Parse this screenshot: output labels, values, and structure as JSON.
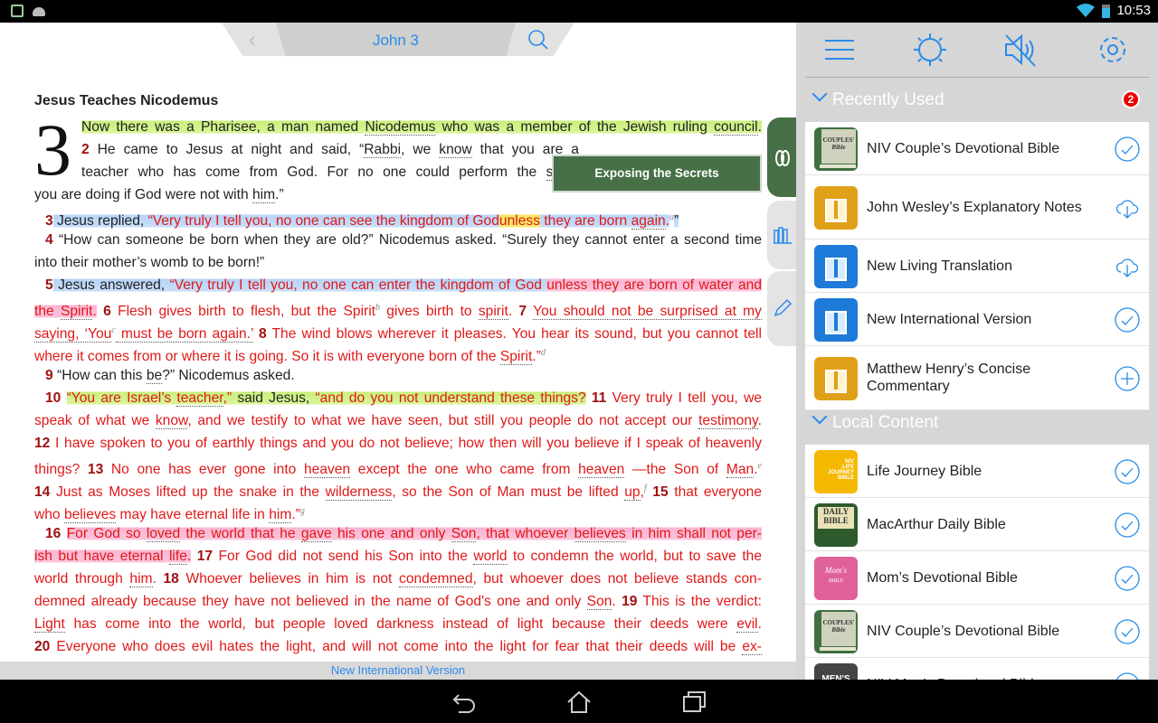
{
  "status": {
    "time": "10:53"
  },
  "header": {
    "chapter": "John 3"
  },
  "passage": {
    "heading": "Jesus Teaches Nicodemus",
    "chapter_number": "3",
    "promo_label": "Exposing the Secrets",
    "lines": [
      {
        "j": 1,
        "s": [
          [
            "Now there was a Pharisee, a man named ",
            "g"
          ],
          [
            "Nicodemus",
            "gu"
          ],
          [
            " who was a member of the Jewish ruling ",
            "g"
          ],
          [
            "council",
            "gu"
          ],
          [
            ".",
            "g"
          ]
        ]
      },
      {
        "j": 1,
        "s": [
          [
            "2",
            "v"
          ],
          [
            " He came to Jesus at night and said, “",
            ""
          ],
          [
            "Rabbi",
            "u"
          ],
          [
            ", we ",
            ""
          ],
          [
            "know",
            "u"
          ],
          [
            " that you are a",
            ""
          ]
        ]
      },
      {
        "j": 1,
        "s": [
          [
            "teacher who has come from God. For no one could perform the ",
            ""
          ],
          [
            "signs",
            "u"
          ]
        ]
      },
      {
        "j": 0,
        "s": [
          [
            "you are doing if God were not with ",
            ""
          ],
          [
            "him",
            "u"
          ],
          [
            ".”",
            ""
          ]
        ]
      },
      {
        "j": 0,
        "i": 1,
        "s": [
          [
            "3",
            "v"
          ],
          [
            " Jesus replied, ",
            "b"
          ],
          [
            "“Very truly I tell you, no one can see the kingdom of God",
            "rb"
          ],
          [
            "unless",
            "ry"
          ],
          [
            " they are born ",
            "rb"
          ],
          [
            "again",
            "rbu"
          ],
          [
            ".",
            "rb"
          ],
          [
            "a",
            "sup"
          ],
          [
            "”",
            "b"
          ]
        ]
      },
      {
        "j": 1,
        "i": 1,
        "s": [
          [
            "4",
            "v"
          ],
          [
            " “How can someone be born when they are old?” Nicodemus asked. “Surely they cannot enter a second time",
            ""
          ]
        ]
      },
      {
        "j": 0,
        "s": [
          [
            "into their mother’s womb to be born!”",
            ""
          ]
        ]
      },
      {
        "j": 1,
        "i": 1,
        "s": [
          [
            "5",
            "v"
          ],
          [
            " Jesus answered, ",
            "b"
          ],
          [
            "“Very truly I tell you, no one can enter the kingdom of God ",
            "rb"
          ],
          [
            "unless they are born of water and",
            "rp"
          ]
        ]
      },
      {
        "j": 1,
        "s": [
          [
            "the ",
            "rp"
          ],
          [
            "Spirit",
            "rpu"
          ],
          [
            ".",
            "rp"
          ],
          [
            " ",
            ""
          ],
          [
            "6",
            "v"
          ],
          [
            " Flesh gives birth to flesh, but the Spirit",
            "r"
          ],
          [
            "b",
            "sup"
          ],
          [
            " gives birth to ",
            "r"
          ],
          [
            "spirit",
            "ru"
          ],
          [
            ". ",
            "r"
          ],
          [
            "7",
            "v"
          ],
          [
            " ",
            ""
          ],
          [
            "You should not be surprised at my",
            "ru"
          ]
        ]
      },
      {
        "j": 1,
        "s": [
          [
            "saying, ‘You",
            "ru"
          ],
          [
            "c",
            "sup"
          ],
          [
            " must be born again.’",
            "ru"
          ],
          [
            " ",
            ""
          ],
          [
            "8",
            "v"
          ],
          [
            " The wind blows wherever it pleases. You hear its sound, but you cannot tell",
            "r"
          ]
        ]
      },
      {
        "j": 0,
        "s": [
          [
            "where it comes from or where it is going. So it is with everyone born of the ",
            "r"
          ],
          [
            "Spirit",
            "ru"
          ],
          [
            ".”",
            "r"
          ],
          [
            "d",
            "sup"
          ]
        ]
      },
      {
        "j": 0,
        "i": 1,
        "s": [
          [
            "9",
            "v"
          ],
          [
            " “How can this ",
            ""
          ],
          [
            "be",
            "u"
          ],
          [
            "?” Nicodemus asked.",
            ""
          ]
        ]
      },
      {
        "j": 1,
        "i": 1,
        "s": [
          [
            "10",
            "v"
          ],
          [
            " ",
            ""
          ],
          [
            "“You are Israel’s ",
            "rg"
          ],
          [
            "teacher",
            "rgu"
          ],
          [
            ",”",
            "rg"
          ],
          [
            " said Jesus, ",
            "g"
          ],
          [
            "“and do you not understand these things?",
            "rg"
          ],
          [
            " ",
            ""
          ],
          [
            "11",
            "v"
          ],
          [
            " Very truly I tell you, we",
            "r"
          ]
        ]
      },
      {
        "j": 1,
        "s": [
          [
            "speak of what we ",
            "r"
          ],
          [
            "know",
            "ru"
          ],
          [
            ", and we testify to what we have seen, but still you people do not accept our ",
            "r"
          ],
          [
            "testimony",
            "ru"
          ],
          [
            ".",
            "r"
          ]
        ]
      },
      {
        "j": 1,
        "s": [
          [
            "12",
            "v"
          ],
          [
            " I have spoken to you of earthly things and you do not believe; how then will you believe if I speak of heavenly",
            "r"
          ]
        ]
      },
      {
        "j": 1,
        "s": [
          [
            "things? ",
            "r"
          ],
          [
            "13",
            "v"
          ],
          [
            " No one has ever gone into ",
            "r"
          ],
          [
            "heaven",
            "ru"
          ],
          [
            " except the one who came from ",
            "r"
          ],
          [
            "heaven",
            "ru"
          ],
          [
            " —the Son of ",
            "r"
          ],
          [
            "Man",
            "ru"
          ],
          [
            ".",
            "r"
          ],
          [
            "e",
            "sup"
          ]
        ]
      },
      {
        "j": 1,
        "s": [
          [
            "14",
            "v"
          ],
          [
            " Just as Moses lifted up the snake in the ",
            "r"
          ],
          [
            "wilderness",
            "ru"
          ],
          [
            ", so the Son of Man must be lifted ",
            "r"
          ],
          [
            "up",
            "ru"
          ],
          [
            ",",
            "r"
          ],
          [
            "f",
            "sup"
          ],
          [
            " ",
            ""
          ],
          [
            "15",
            "v"
          ],
          [
            " that everyone",
            "r"
          ]
        ]
      },
      {
        "j": 0,
        "s": [
          [
            "who ",
            "r"
          ],
          [
            "believes",
            "ru"
          ],
          [
            " may have eternal life in ",
            "r"
          ],
          [
            "him",
            "ru"
          ],
          [
            ".”",
            "r"
          ],
          [
            "g",
            "sup"
          ]
        ]
      },
      {
        "j": 1,
        "i": 1,
        "s": [
          [
            "16",
            "v"
          ],
          [
            " ",
            ""
          ],
          [
            "For God so ",
            "rp"
          ],
          [
            "loved",
            "rpu"
          ],
          [
            " the world that he ",
            "rp"
          ],
          [
            "gave",
            "rpu"
          ],
          [
            " his one and only ",
            "rp"
          ],
          [
            "Son",
            "rpu"
          ],
          [
            ", that whoever ",
            "rp"
          ],
          [
            "believes",
            "rpu"
          ],
          [
            " in him shall not per-",
            "rp"
          ]
        ]
      },
      {
        "j": 1,
        "s": [
          [
            "ish but have eternal ",
            "rp"
          ],
          [
            "life",
            "rpu"
          ],
          [
            ".",
            "rp"
          ],
          [
            " ",
            ""
          ],
          [
            "17",
            "v"
          ],
          [
            " For God did not send his Son into the ",
            "r"
          ],
          [
            "world",
            "ru"
          ],
          [
            " to condemn the world, but to save the",
            "r"
          ]
        ]
      },
      {
        "j": 1,
        "s": [
          [
            "world through ",
            "r"
          ],
          [
            "him",
            "ru"
          ],
          [
            ". ",
            "r"
          ],
          [
            "18",
            "v"
          ],
          [
            " Whoever believes in him is not ",
            "r"
          ],
          [
            "condemned",
            "ru"
          ],
          [
            ", but whoever does not believe stands con-",
            "r"
          ]
        ]
      },
      {
        "j": 1,
        "s": [
          [
            "demned already because they have not believed in the name of God's one and only ",
            "r"
          ],
          [
            "Son",
            "ru"
          ],
          [
            ". ",
            "r"
          ],
          [
            "19",
            "v"
          ],
          [
            " This is the verdict:",
            "r"
          ]
        ]
      },
      {
        "j": 1,
        "s": [
          [
            "Light",
            "ru"
          ],
          [
            " has come into the world, but people loved darkness instead of light because their deeds were ",
            "r"
          ],
          [
            "evil",
            "ru"
          ],
          [
            ".",
            "r"
          ]
        ]
      },
      {
        "j": 1,
        "s": [
          [
            "20",
            "v"
          ],
          [
            " Everyone who does evil hates the light, and will not come into the light for fear that their deeds will be ",
            "r"
          ],
          [
            "ex-",
            "ru"
          ]
        ]
      }
    ]
  },
  "footer": {
    "version": "New International Version"
  },
  "panel": {
    "recent": {
      "title": "Recently Used",
      "badge": "2",
      "items": [
        {
          "name": "NIV Couple’s Devotional Bible",
          "cover": "couples",
          "action": "check"
        },
        {
          "name": "John Wesley’s Explanatory Notes",
          "cover": "orange",
          "action": "download"
        },
        {
          "name": "New Living Translation",
          "cover": "blue",
          "action": "download"
        },
        {
          "name": "New International Version",
          "cover": "blue",
          "action": "check"
        },
        {
          "name": "Matthew Henry’s Concise Commentary",
          "cover": "orange",
          "action": "add"
        }
      ]
    },
    "local": {
      "title": "Local Content",
      "items": [
        {
          "name": "Life Journey Bible",
          "cover": "yellow",
          "action": "check"
        },
        {
          "name": "MacArthur Daily Bible",
          "cover": "macarthur",
          "action": "check"
        },
        {
          "name": "Mom’s Devotional Bible",
          "cover": "pink",
          "action": "check"
        },
        {
          "name": "NIV Couple’s Devotional Bible",
          "cover": "couples",
          "action": "check"
        },
        {
          "name": "NIV Men’s Devotional Bible",
          "cover": "mens",
          "action": "check"
        }
      ]
    }
  },
  "colors": {
    "accent": "#2a8bea",
    "green": "#477046",
    "words_of_christ": "#e01818"
  }
}
